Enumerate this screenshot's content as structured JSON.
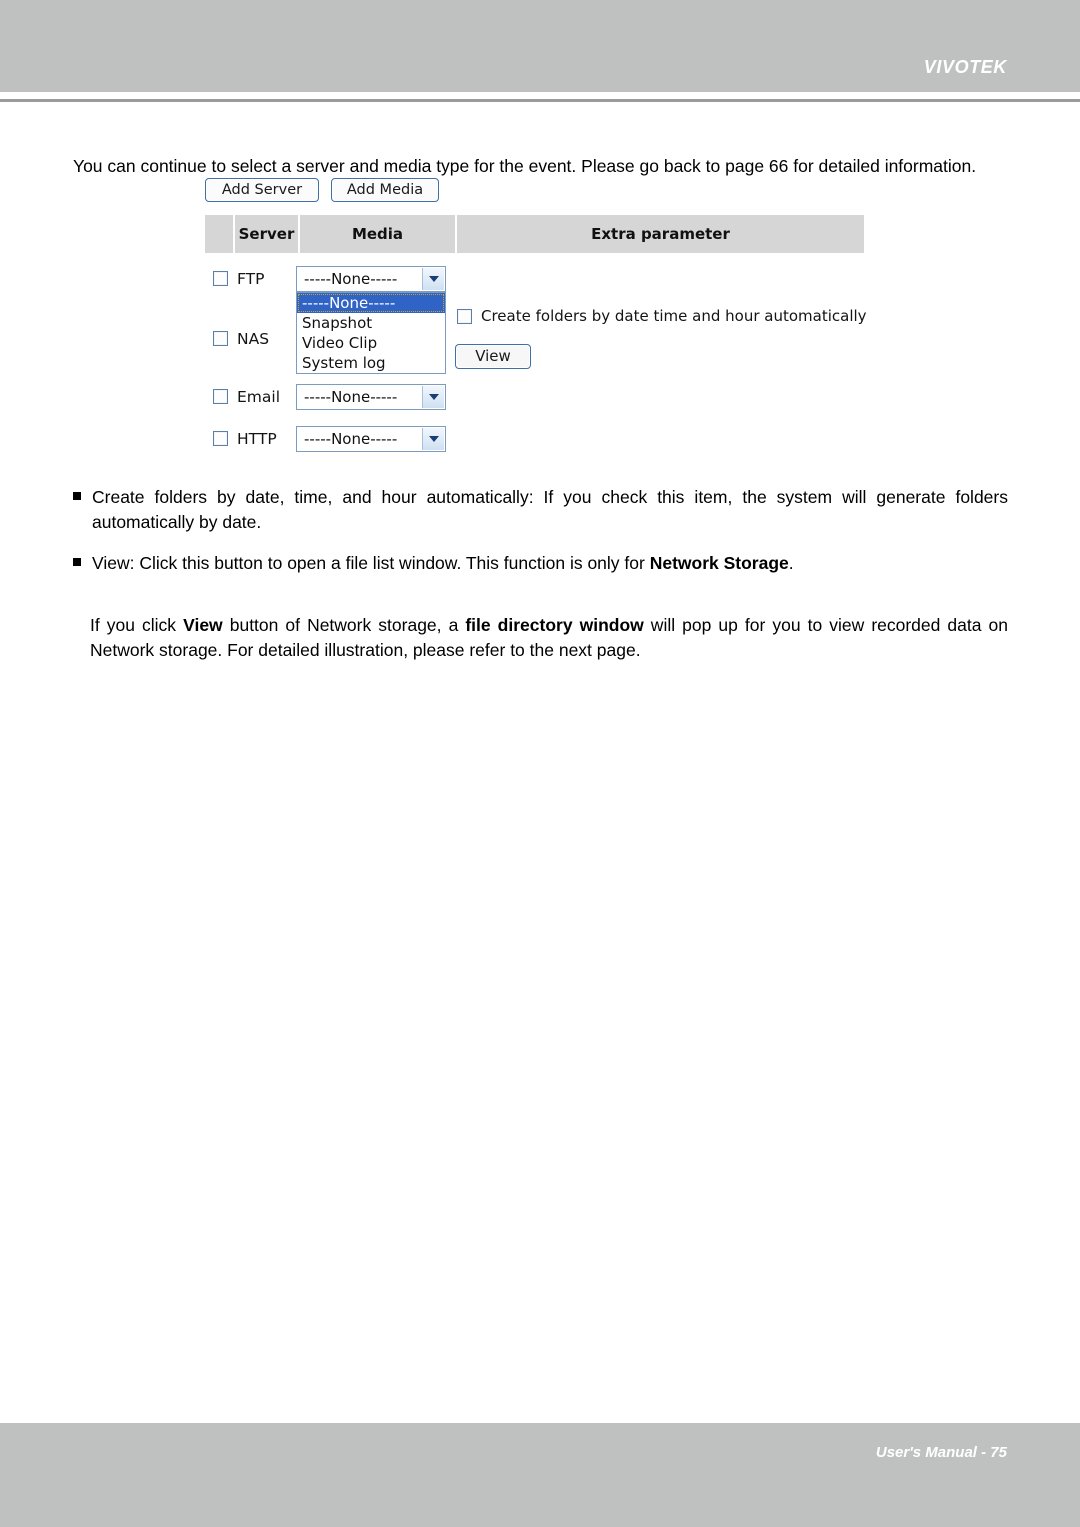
{
  "header": {
    "brand": "VIVOTEK"
  },
  "intro": {
    "text": "You can continue to select a server and media type for the event. Please go back to page 66 for detailed information."
  },
  "widget": {
    "buttons": {
      "add_server": "Add Server",
      "add_media": "Add Media"
    },
    "table_headers": {
      "blank": "",
      "server": "Server",
      "media": "Media",
      "extra": "Extra parameter"
    },
    "rows": [
      {
        "label": "FTP",
        "select_value": "-----None-----"
      },
      {
        "label": "NAS",
        "select_value": ""
      },
      {
        "label": "Email",
        "select_value": "-----None-----"
      },
      {
        "label": "HTTP",
        "select_value": "-----None-----"
      }
    ],
    "dropdown_options": [
      "-----None-----",
      "Snapshot",
      "Video Clip",
      "System log"
    ],
    "dropdown_selected": "-----None-----",
    "extra": {
      "checkbox_label": "Create folders by date time and hour automatically",
      "view_button": "View"
    },
    "colors": {
      "table_header_bg": "#d6d6d6",
      "option_highlight": "#3063c6",
      "button_border": "#3f6fa5"
    }
  },
  "bullets": [
    {
      "lead": "Create folders by date, time, and hour automatically:",
      "rest": " If you check this item, the system will generate folders automatically by date."
    },
    {
      "lead": "View:",
      "rest": " Click this button to open a file list window. This function is only for ",
      "bold_tail": "Network Storage",
      "tail_end": "."
    }
  ],
  "final_paragraph": {
    "part1": "If you click ",
    "bold1": "View",
    "part2": " button of Network storage, a ",
    "bold2": "file directory window",
    "part3": " will pop up for you to view recorded data on Network storage. For detailed illustration, please refer to the next page."
  },
  "footer": {
    "text": "User's Manual - 75"
  }
}
